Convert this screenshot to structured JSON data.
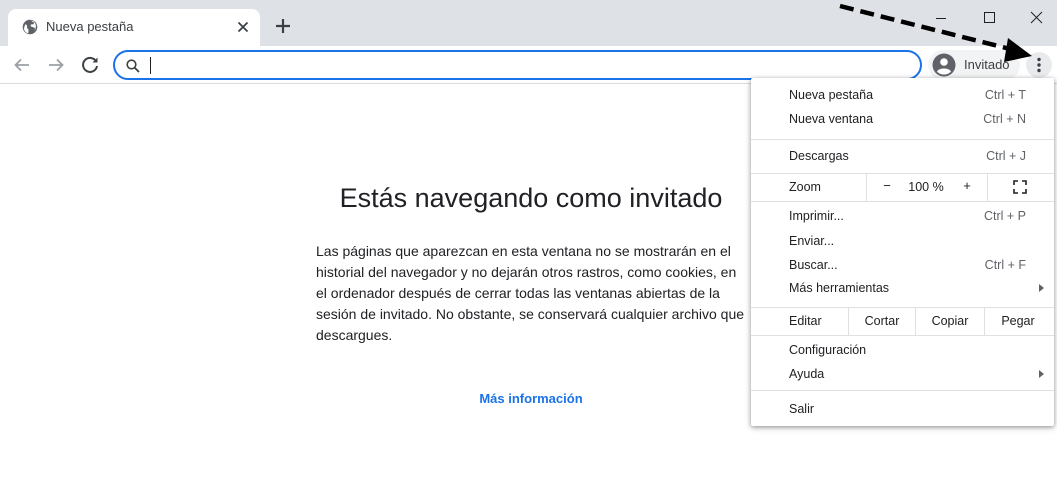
{
  "tab": {
    "title": "Nueva pestaña",
    "favicon": "globe-icon"
  },
  "window": {
    "buttons": [
      "minimize-icon",
      "maximize-icon",
      "close-icon"
    ]
  },
  "toolbar": {
    "omnibox_value": "",
    "omnibox_icon": "search-icon",
    "profile_label": "Invitado"
  },
  "page": {
    "heading": "Estás navegando como invitado",
    "body": "Las páginas que aparezcan en esta ventana no se mostrarán en el historial del navegador y no dejarán otros rastros, como cookies, en el ordenador después de cerrar todas las ventanas abiertas de la sesión de invitado. No obstante, se conservará cualquier archivo que descargues.",
    "link": "Más información"
  },
  "menu": {
    "new_tab": {
      "label": "Nueva pestaña",
      "shortcut": "Ctrl + T"
    },
    "new_window": {
      "label": "Nueva ventana",
      "shortcut": "Ctrl + N"
    },
    "downloads": {
      "label": "Descargas",
      "shortcut": "Ctrl + J"
    },
    "zoom": {
      "label": "Zoom",
      "minus": "−",
      "value": "100 %",
      "plus": "+"
    },
    "print": {
      "label": "Imprimir...",
      "shortcut": "Ctrl + P"
    },
    "cast": {
      "label": "Enviar..."
    },
    "find": {
      "label": "Buscar...",
      "shortcut": "Ctrl + F"
    },
    "more_tools": {
      "label": "Más herramientas"
    },
    "edit": {
      "label": "Editar",
      "cut": "Cortar",
      "copy": "Copiar",
      "paste": "Pegar"
    },
    "settings": {
      "label": "Configuración"
    },
    "help": {
      "label": "Ayuda"
    },
    "exit": {
      "label": "Salir"
    }
  },
  "colors": {
    "accent": "#1a73e8",
    "tabstrip": "#dee1e6",
    "text": "#202124"
  }
}
